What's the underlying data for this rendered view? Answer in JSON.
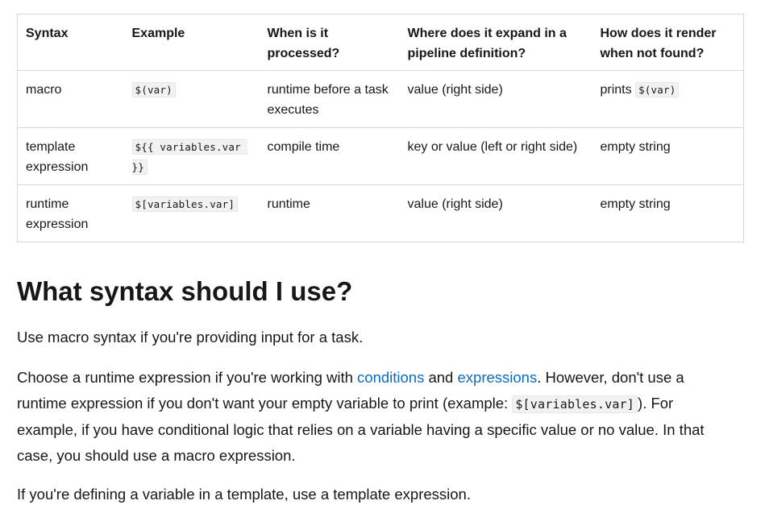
{
  "table": {
    "headers": [
      "Syntax",
      "Example",
      "When is it processed?",
      "Where does it expand in a pipeline definition?",
      "How does it render when not found?"
    ],
    "rows": [
      {
        "syntax": "macro",
        "example": "$(var)",
        "when": "runtime before a task executes",
        "where": "value (right side)",
        "render_text": "prints",
        "render_code": "$(var)"
      },
      {
        "syntax": "template expression",
        "example": "${{ variables.var }}",
        "when": "compile time",
        "where": "key or value (left or right side)",
        "render_text": "empty string",
        "render_code": ""
      },
      {
        "syntax": "runtime expression",
        "example": "$[variables.var]",
        "when": "runtime",
        "where": "value (right side)",
        "render_text": "empty string",
        "render_code": ""
      }
    ]
  },
  "section": {
    "heading": "What syntax should I use?",
    "p1": "Use macro syntax if you're providing input for a task.",
    "p2": {
      "t1": "Choose a runtime expression if you're working with ",
      "link1": "conditions",
      "t2": " and ",
      "link2": "expressions",
      "t3": ". However, don't use a runtime expression if you don't want your empty variable to print (example: ",
      "code": "$[variables.var]",
      "t4": "). For example, if you have conditional logic that relies on a variable having a specific value or no value. In that case, you should use a macro expression."
    },
    "p3": "If you're defining a variable in a template, use a template expression."
  },
  "colors": {
    "link": "#0f6cbd",
    "text": "#171717",
    "border": "#d6d6d6",
    "code_bg": "#f2f2f2"
  }
}
